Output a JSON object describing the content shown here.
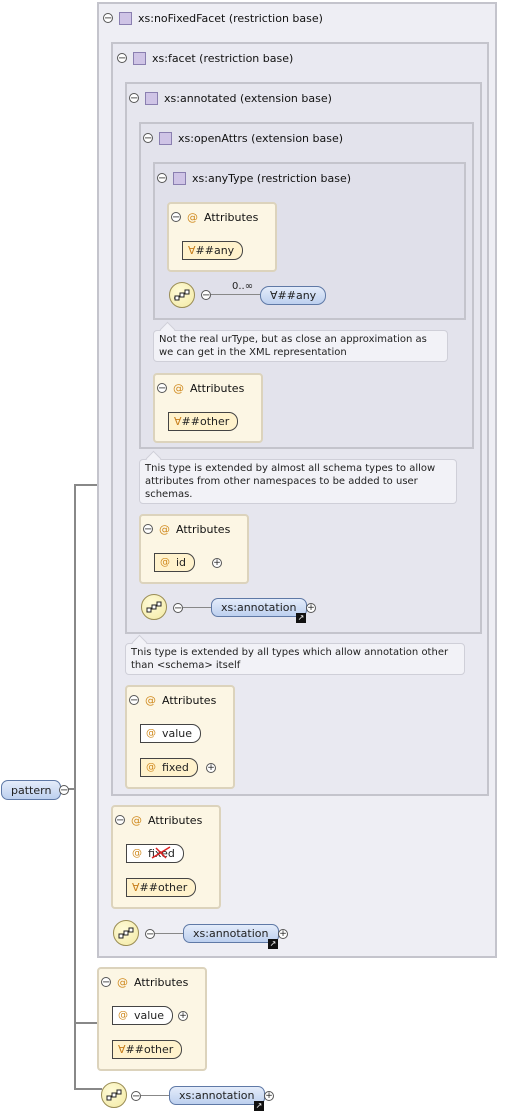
{
  "root": {
    "label": "pattern"
  },
  "noFixedFacet": {
    "title": "xs:noFixedFacet (restriction base)"
  },
  "facet": {
    "title": "xs:facet (restriction base)"
  },
  "annotated": {
    "title": "xs:annotated (extension base)"
  },
  "openAttrs": {
    "title": "xs:openAttrs (extension base)"
  },
  "anyType": {
    "title": "xs:anyType (restriction base)",
    "attributes_label": "Attributes",
    "any_attr": "##any",
    "cardinality": "0..∞",
    "any_element": "##any",
    "note": "Not the real urType, but as close an approximation as we can get in the XML representation"
  },
  "openAttrs_attrs": {
    "label": "Attributes",
    "other": "##other"
  },
  "openAttrs_note": "This type is extended by almost all schema types to allow attributes from other namespaces to be added to user schemas.",
  "annotated_attrs": {
    "label": "Attributes",
    "id": "id"
  },
  "annotated_seq": {
    "annotation": "xs:annotation"
  },
  "annotated_note": "This type is extended by all types which allow annotation other than <schema> itself",
  "facet_attrs": {
    "label": "Attributes",
    "value": "value",
    "fixed": "fixed"
  },
  "noFixed_attrs": {
    "label": "Attributes",
    "fixed": "fixed",
    "other": "##other"
  },
  "noFixed_seq": {
    "annotation": "xs:annotation"
  },
  "pattern_attrs": {
    "label": "Attributes",
    "value": "value",
    "other": "##other"
  },
  "pattern_seq": {
    "annotation": "xs:annotation"
  },
  "symbols": {
    "collapse": "−",
    "expand": "+",
    "at": "@",
    "wildcard": "∀"
  }
}
